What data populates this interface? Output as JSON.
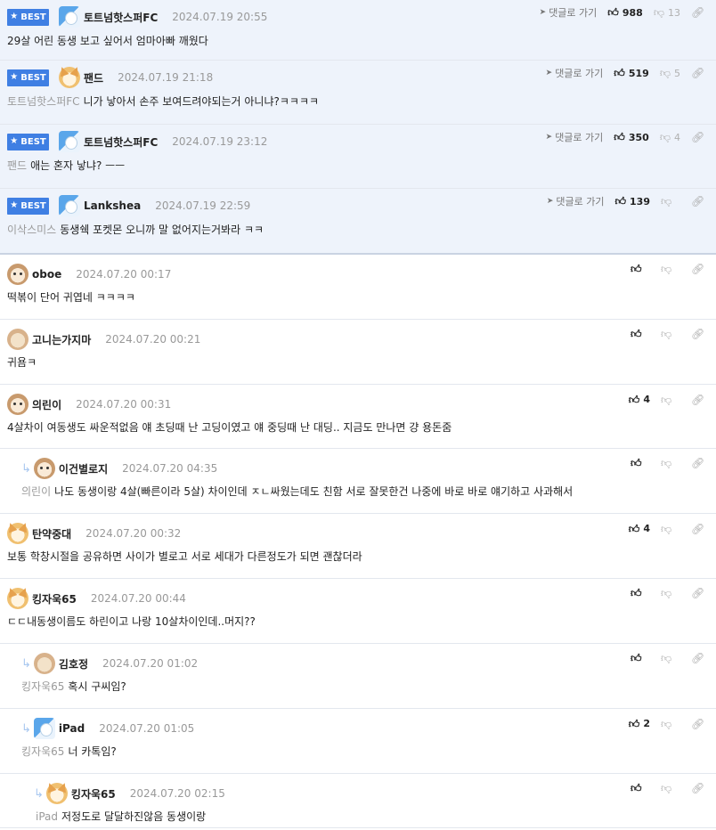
{
  "labels": {
    "best": "BEST",
    "reply_to": "댓글로 가기"
  },
  "comments": [
    {
      "best": true,
      "avatar": "blue",
      "name": "토트넘핫스퍼FC",
      "date": "2024.07.19 20:55",
      "ref": "",
      "text": "29살 어린 동생 보고 싶어서 엄마아빠 깨웠다",
      "up": "988",
      "down": "13",
      "indent": 0
    },
    {
      "best": true,
      "avatar": "dog",
      "name": "팬드",
      "date": "2024.07.19 21:18",
      "ref": "토트넘핫스퍼FC",
      "text": "니가 낳아서 손주 보여드려야되는거 아니냐?ㅋㅋㅋㅋ",
      "up": "519",
      "down": "5",
      "indent": 0
    },
    {
      "best": true,
      "avatar": "blue",
      "name": "토트넘핫스퍼FC",
      "date": "2024.07.19 23:12",
      "ref": "팬드",
      "text": "애는 혼자 낳냐? ㅡㅡ",
      "up": "350",
      "down": "4",
      "indent": 0
    },
    {
      "best": true,
      "avatar": "blue",
      "name": "Lankshea",
      "date": "2024.07.19 22:59",
      "ref": "이삭스미스",
      "text": "동생쉑 포켓몬 오니까 말 없어지는거봐라 ㅋㅋ",
      "up": "139",
      "down": "",
      "indent": 0
    },
    {
      "best": false,
      "avatar": "puppy",
      "name": "oboe",
      "date": "2024.07.20 00:17",
      "ref": "",
      "text": "떡볶이 단어 귀엽네 ㅋㅋㅋㅋ",
      "up": "",
      "down": "",
      "indent": 0
    },
    {
      "best": false,
      "avatar": "plain",
      "name": "고니는가지마",
      "date": "2024.07.20 00:21",
      "ref": "",
      "text": "귀욤ㅋ",
      "up": "",
      "down": "",
      "indent": 0
    },
    {
      "best": false,
      "avatar": "puppy",
      "name": "의린이",
      "date": "2024.07.20 00:31",
      "ref": "",
      "text": "4살차이 여동생도 싸운적없음 얘 초딩때 난 고딩이였고 얘 중딩때 난 대딩.. 지금도 만나면 걍 용돈줌",
      "up": "4",
      "down": "",
      "indent": 0
    },
    {
      "best": false,
      "avatar": "puppy",
      "name": "이건별로지",
      "date": "2024.07.20 04:35",
      "ref": "의린이",
      "text": "나도 동생이랑 4살(빠른이라 5살) 차이인데 ㅈㄴ싸웠는데도 친함 서로 잘못한건 나중에 바로 바로 얘기하고 사과해서",
      "up": "",
      "down": "",
      "indent": 1
    },
    {
      "best": false,
      "avatar": "dog",
      "name": "탄약중대",
      "date": "2024.07.20 00:32",
      "ref": "",
      "text": "보통 학창시절을 공유하면 사이가 별로고 서로 세대가 다른정도가 되면 괜찮더라",
      "up": "4",
      "down": "",
      "indent": 0
    },
    {
      "best": false,
      "avatar": "dog",
      "name": "킹자욱65",
      "date": "2024.07.20 00:44",
      "ref": "",
      "text": "ㄷㄷ내동생이름도 하린이고 나랑 10살차이인데..머지??",
      "up": "",
      "down": "",
      "indent": 0
    },
    {
      "best": false,
      "avatar": "plain",
      "name": "김호정",
      "date": "2024.07.20 01:02",
      "ref": "킹자욱65",
      "text": "혹시 구씨임?",
      "up": "",
      "down": "",
      "indent": 1
    },
    {
      "best": false,
      "avatar": "blue",
      "name": "iPad",
      "date": "2024.07.20 01:05",
      "ref": "킹자욱65",
      "text": "너 카톡임?",
      "up": "2",
      "down": "",
      "indent": 1
    },
    {
      "best": false,
      "avatar": "dog",
      "name": "킹자욱65",
      "date": "2024.07.20 02:15",
      "ref": "iPad",
      "text": "저정도로 달달하진않음 동생이랑",
      "up": "",
      "down": "",
      "indent": 2
    }
  ]
}
